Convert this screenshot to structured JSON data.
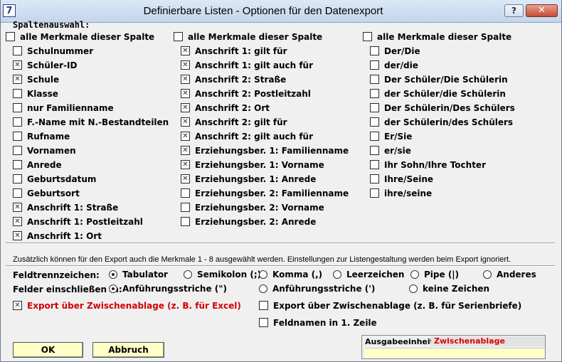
{
  "window": {
    "title": "Definierbare Listen - Optionen für den Datenexport",
    "app_icon": "7",
    "help_label": "?",
    "close_label": "✕"
  },
  "spaltenauswahl_label": "Spaltenauswahl:",
  "columns": [
    {
      "all_label": "alle Merkmale dieser Spalte",
      "all_checked": false,
      "items": [
        {
          "label": "Schulnummer",
          "checked": false
        },
        {
          "label": "Schüler-ID",
          "checked": true
        },
        {
          "label": "Schule",
          "checked": true
        },
        {
          "label": "Klasse",
          "checked": false
        },
        {
          "label": "nur Familienname",
          "checked": false
        },
        {
          "label": "F.-Name mit N.-Bestandteilen",
          "checked": false
        },
        {
          "label": "Rufname",
          "checked": false
        },
        {
          "label": "Vornamen",
          "checked": false
        },
        {
          "label": "Anrede",
          "checked": false
        },
        {
          "label": "Geburtsdatum",
          "checked": false
        },
        {
          "label": "Geburtsort",
          "checked": false
        },
        {
          "label": "Anschrift 1: Straße",
          "checked": true
        },
        {
          "label": "Anschrift 1: Postleitzahl",
          "checked": true
        },
        {
          "label": "Anschrift 1: Ort",
          "checked": true
        }
      ]
    },
    {
      "all_label": "alle Merkmale dieser Spalte",
      "all_checked": false,
      "items": [
        {
          "label": "Anschrift 1: gilt für",
          "checked": true
        },
        {
          "label": "Anschrift 1: gilt auch für",
          "checked": true
        },
        {
          "label": "Anschrift 2: Straße",
          "checked": true
        },
        {
          "label": "Anschrift 2: Postleitzahl",
          "checked": true
        },
        {
          "label": "Anschrift 2: Ort",
          "checked": true
        },
        {
          "label": "Anschrift 2: gilt für",
          "checked": true
        },
        {
          "label": "Anschrift 2: gilt auch für",
          "checked": true
        },
        {
          "label": "Erziehungsber. 1: Familienname",
          "checked": true
        },
        {
          "label": "Erziehungsber. 1: Vorname",
          "checked": true
        },
        {
          "label": "Erziehungsber. 1: Anrede",
          "checked": true
        },
        {
          "label": "Erziehungsber. 2: Familienname",
          "checked": false
        },
        {
          "label": "Erziehungsber. 2: Vorname",
          "checked": false
        },
        {
          "label": "Erziehungsber. 2: Anrede",
          "checked": false
        }
      ]
    },
    {
      "all_label": "alle Merkmale dieser Spalte",
      "all_checked": false,
      "items": [
        {
          "label": "Der/Die",
          "checked": false
        },
        {
          "label": "der/die",
          "checked": false
        },
        {
          "label": "Der Schüler/Die Schülerin",
          "checked": false
        },
        {
          "label": "der Schüler/die Schülerin",
          "checked": false
        },
        {
          "label": "Der Schülerin/Des Schülers",
          "checked": false
        },
        {
          "label": "der Schülerin/des Schülers",
          "checked": false
        },
        {
          "label": "Er/Sie",
          "checked": false
        },
        {
          "label": "er/sie",
          "checked": false
        },
        {
          "label": "Ihr Sohn/Ihre Tochter",
          "checked": false
        },
        {
          "label": "Ihre/Seine",
          "checked": false
        },
        {
          "label": "ihre/seine",
          "checked": false
        }
      ]
    }
  ],
  "note": "Zusätzlich können für den Export auch die Merkmale 1 - 8 ausgewählt werden. Einstellungen zur Listengestaltung werden beim Export ignoriert.",
  "feldtrennzeichen": {
    "label": "Feldtrennzeichen:",
    "options": [
      {
        "label": "Tabulator",
        "checked": true
      },
      {
        "label": "Semikolon (;)",
        "checked": false
      },
      {
        "label": "Komma (,)",
        "checked": false
      },
      {
        "label": "Leerzeichen",
        "checked": false
      },
      {
        "label": "Pipe (|)",
        "checked": false
      },
      {
        "label": "Anderes",
        "checked": false
      }
    ]
  },
  "felder_einschliessen": {
    "label": "Felder einschließen in:",
    "options": [
      {
        "label": "Anführungsstriche (\")",
        "checked": true
      },
      {
        "label": "Anführungsstriche (')",
        "checked": false
      },
      {
        "label": "keine Zeichen",
        "checked": false
      }
    ]
  },
  "export_excel": {
    "label": "Export über Zwischenablage (z. B. für Excel)",
    "checked": true
  },
  "export_serienbriefe": {
    "label": "Export über Zwischenablage (z. B. für Serienbriefe)",
    "checked": false
  },
  "feldnamen": {
    "label": "Feldnamen in 1. Zeile",
    "checked": false
  },
  "buttons": {
    "ok": "OK",
    "abbruch": "Abbruch"
  },
  "ausgabeeinheit": {
    "label": "Ausgabeeinheit:",
    "value": "Zwischenablage"
  },
  "colors": {
    "accent_red": "#d40000",
    "button_yellow": "#ffffc8"
  }
}
